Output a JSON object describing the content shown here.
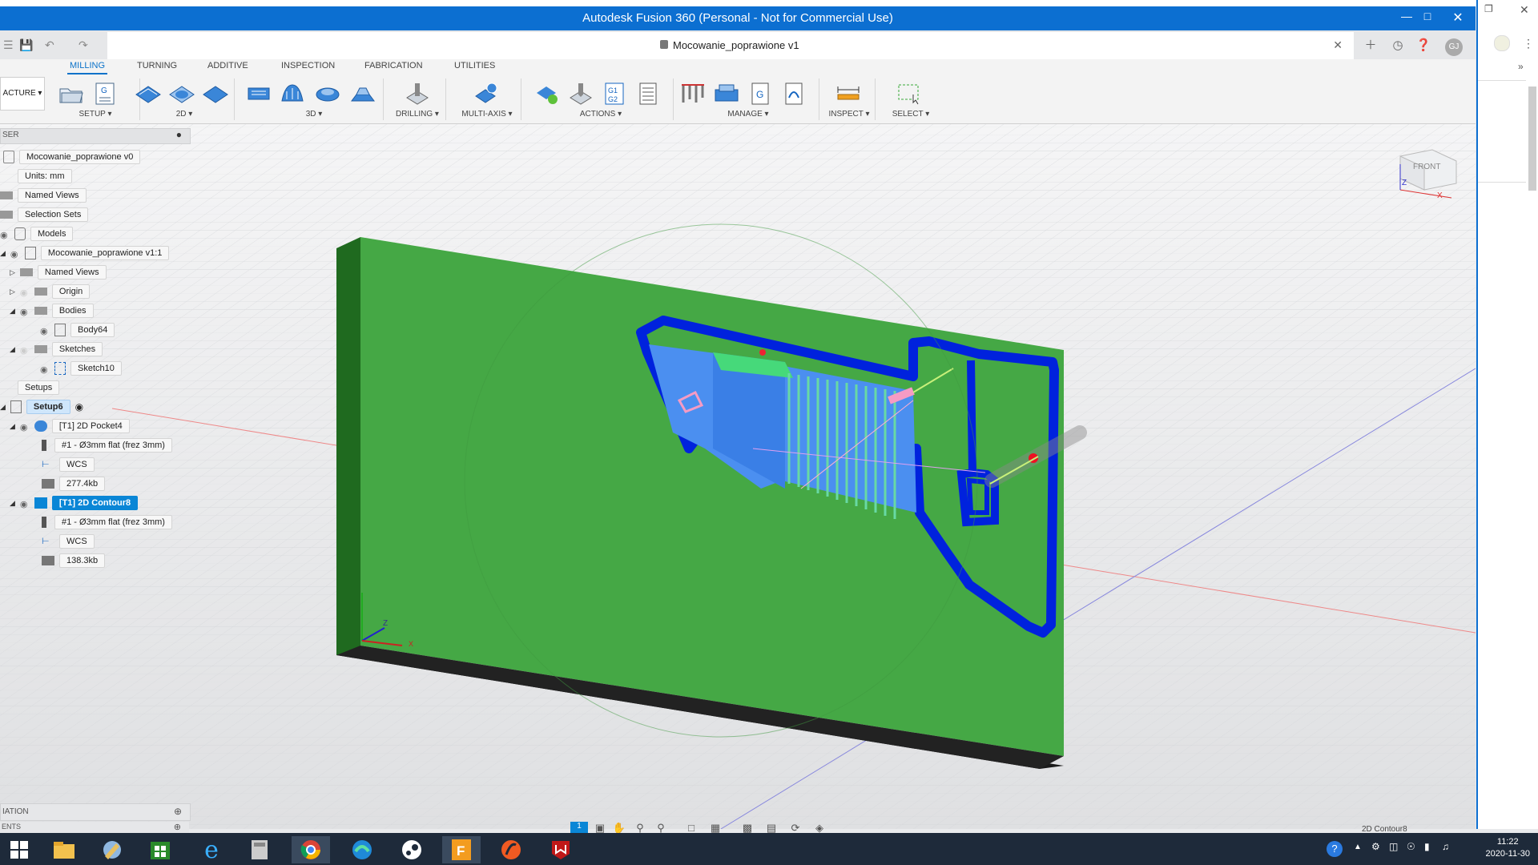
{
  "window": {
    "title": "Autodesk Fusion 360 (Personal - Not for Commercial Use)"
  },
  "document": {
    "name": "Mocowanie_poprawione v1"
  },
  "ribbon": {
    "workspace": "ACTURE",
    "tabs": [
      "MILLING",
      "TURNING",
      "ADDITIVE",
      "INSPECTION",
      "FABRICATION",
      "UTILITIES"
    ],
    "groups": {
      "setup": "SETUP",
      "twod": "2D",
      "threed": "3D",
      "drilling": "DRILLING",
      "multiaxis": "MULTI-AXIS",
      "actions": "ACTIONS",
      "manage": "MANAGE",
      "inspect": "INSPECT",
      "select": "SELECT"
    }
  },
  "browser": {
    "header": "SER",
    "root": "Mocowanie_poprawione v0",
    "units": "Units: mm",
    "named_views": "Named Views",
    "selection_sets": "Selection Sets",
    "models": "Models",
    "model_item": "Mocowanie_poprawione v1:1",
    "model_named_views": "Named Views",
    "origin": "Origin",
    "bodies": "Bodies",
    "body": "Body64",
    "sketches": "Sketches",
    "sketch": "Sketch10",
    "setups": "Setups",
    "setup": "Setup6",
    "op1": {
      "name": "[T1] 2D Pocket4",
      "tool": "#1 - Ø3mm flat (frez 3mm)",
      "wcs": "WCS",
      "size": "277.4kb"
    },
    "op2": {
      "name": "[T1] 2D Contour8",
      "tool": "#1 - Ø3mm flat (frez 3mm)",
      "wcs": "WCS",
      "size": "138.3kb"
    }
  },
  "panels": {
    "simulation": "IATION",
    "comments": "ENTS"
  },
  "viewcube": {
    "face": "FRONT",
    "axis_z": "Z",
    "axis_x": "X"
  },
  "axes": {
    "z": "Z",
    "x": "X"
  },
  "status_text": "2D Contour8",
  "clock": {
    "time": "11:22",
    "date": "2020-11-30"
  },
  "nav": {
    "first": "1"
  }
}
